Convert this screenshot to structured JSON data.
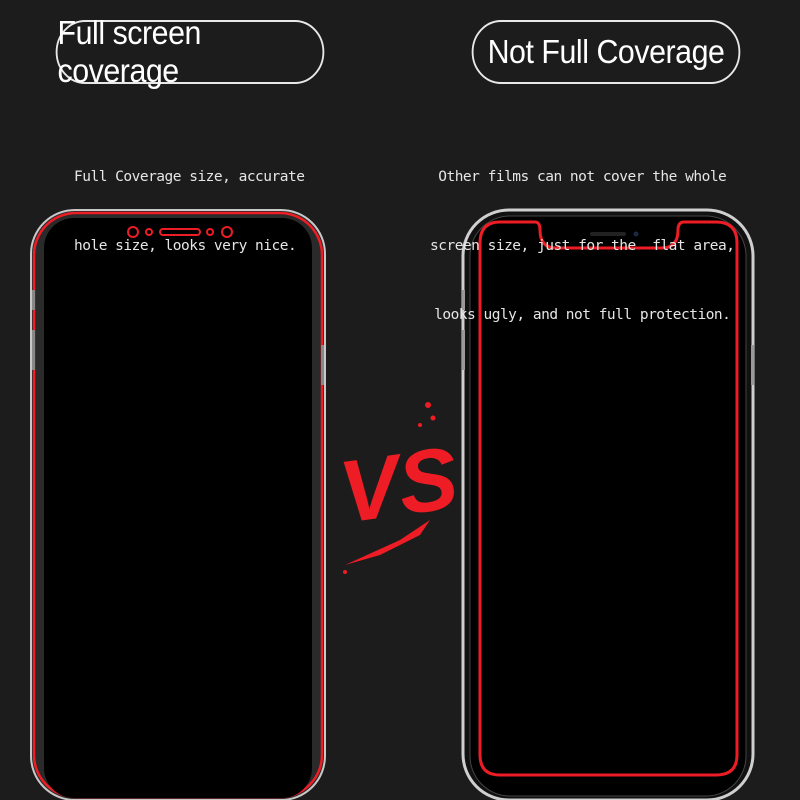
{
  "left": {
    "title": "Full screen coverage",
    "description_lines": [
      "Full Coverage size, accurate",
      "hole size, looks very nice."
    ]
  },
  "right": {
    "title": "Not Full Coverage",
    "description_lines": [
      "Other films can not cover the whole",
      "screen size, just for the  flat area,",
      "looks ugly, and not full protection."
    ]
  },
  "vs_logo": "VS",
  "colors": {
    "background": "#1c1c1c",
    "accent_red": "#ee1c24",
    "phone_frame": "#bfbfbf"
  }
}
